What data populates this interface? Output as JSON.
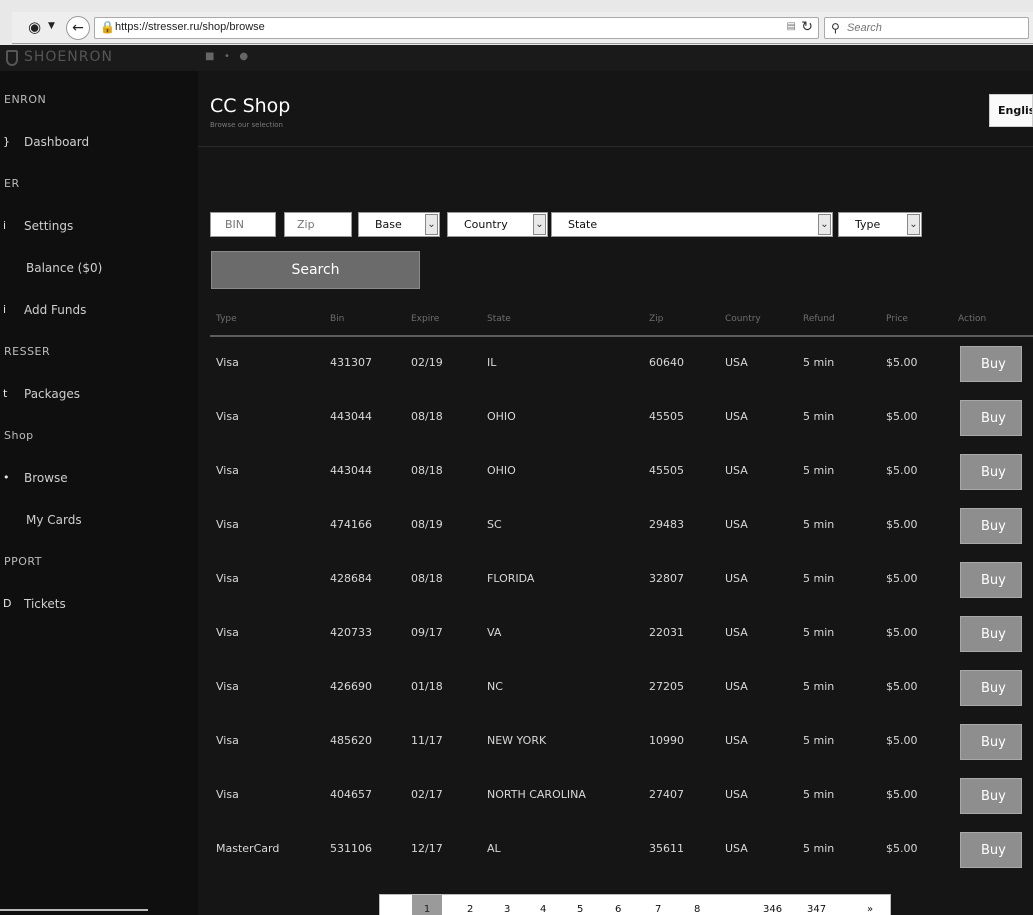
{
  "browser": {
    "url": "https://stresser.ru/shop/browse",
    "search_placeholder": "Search"
  },
  "topbar": {
    "logo_text": "SHOENRON"
  },
  "sidebar": {
    "items": [
      {
        "label": "ENRON",
        "icon": "",
        "type": "section"
      },
      {
        "label": "Dashboard",
        "icon": "}",
        "type": "item"
      },
      {
        "label": "ER",
        "icon": "",
        "type": "section"
      },
      {
        "label": "Settings",
        "icon": "i",
        "type": "item"
      },
      {
        "label": "Balance ($0)",
        "icon": "",
        "type": "item"
      },
      {
        "label": "Add Funds",
        "icon": "i",
        "type": "item"
      },
      {
        "label": "RESSER",
        "icon": "",
        "type": "section"
      },
      {
        "label": "Packages",
        "icon": "t",
        "type": "item"
      },
      {
        "label": "Shop",
        "icon": "",
        "type": "section"
      },
      {
        "label": "Browse",
        "icon": "•",
        "type": "item"
      },
      {
        "label": "My Cards",
        "icon": "",
        "type": "item"
      },
      {
        "label": "PPORT",
        "icon": "",
        "type": "section"
      },
      {
        "label": "Tickets",
        "icon": "D",
        "type": "item"
      }
    ]
  },
  "header": {
    "title": "CC Shop",
    "subtitle": "Browse our selection",
    "language": "English"
  },
  "filters": {
    "bin_placeholder": "BIN",
    "zip_placeholder": "Zip",
    "base_label": "Base",
    "country_label": "Country",
    "state_label": "State",
    "type_label": "Type",
    "search_label": "Search"
  },
  "table": {
    "columns": [
      "Type",
      "Bin",
      "Expire",
      "State",
      "Zip",
      "Country",
      "Refund",
      "Price",
      "Action"
    ],
    "buy_label": "Buy",
    "rows": [
      {
        "type": "Visa",
        "bin": "431307",
        "expire": "02/19",
        "state": "IL",
        "zip": "60640",
        "country": "USA",
        "refund": "5 min",
        "price": "$5.00"
      },
      {
        "type": "Visa",
        "bin": "443044",
        "expire": "08/18",
        "state": "OHIO",
        "zip": "45505",
        "country": "USA",
        "refund": "5 min",
        "price": "$5.00"
      },
      {
        "type": "Visa",
        "bin": "443044",
        "expire": "08/18",
        "state": "OHIO",
        "zip": "45505",
        "country": "USA",
        "refund": "5 min",
        "price": "$5.00"
      },
      {
        "type": "Visa",
        "bin": "474166",
        "expire": "08/19",
        "state": "SC",
        "zip": "29483",
        "country": "USA",
        "refund": "5 min",
        "price": "$5.00"
      },
      {
        "type": "Visa",
        "bin": "428684",
        "expire": "08/18",
        "state": "FLORIDA",
        "zip": "32807",
        "country": "USA",
        "refund": "5 min",
        "price": "$5.00"
      },
      {
        "type": "Visa",
        "bin": "420733",
        "expire": "09/17",
        "state": "VA",
        "zip": "22031",
        "country": "USA",
        "refund": "5 min",
        "price": "$5.00"
      },
      {
        "type": "Visa",
        "bin": "426690",
        "expire": "01/18",
        "state": "NC",
        "zip": "27205",
        "country": "USA",
        "refund": "5 min",
        "price": "$5.00"
      },
      {
        "type": "Visa",
        "bin": "485620",
        "expire": "11/17",
        "state": "NEW YORK",
        "zip": "10990",
        "country": "USA",
        "refund": "5 min",
        "price": "$5.00"
      },
      {
        "type": "Visa",
        "bin": "404657",
        "expire": "02/17",
        "state": "NORTH CAROLINA",
        "zip": "27407",
        "country": "USA",
        "refund": "5 min",
        "price": "$5.00"
      },
      {
        "type": "MasterCard",
        "bin": "531106",
        "expire": "12/17",
        "state": "AL",
        "zip": "35611",
        "country": "USA",
        "refund": "5 min",
        "price": "$5.00"
      }
    ]
  },
  "pagination": {
    "pages": [
      "1",
      "2",
      "3",
      "4",
      "5",
      "6",
      "7",
      "8",
      "346",
      "347",
      "»"
    ],
    "active": "1"
  }
}
